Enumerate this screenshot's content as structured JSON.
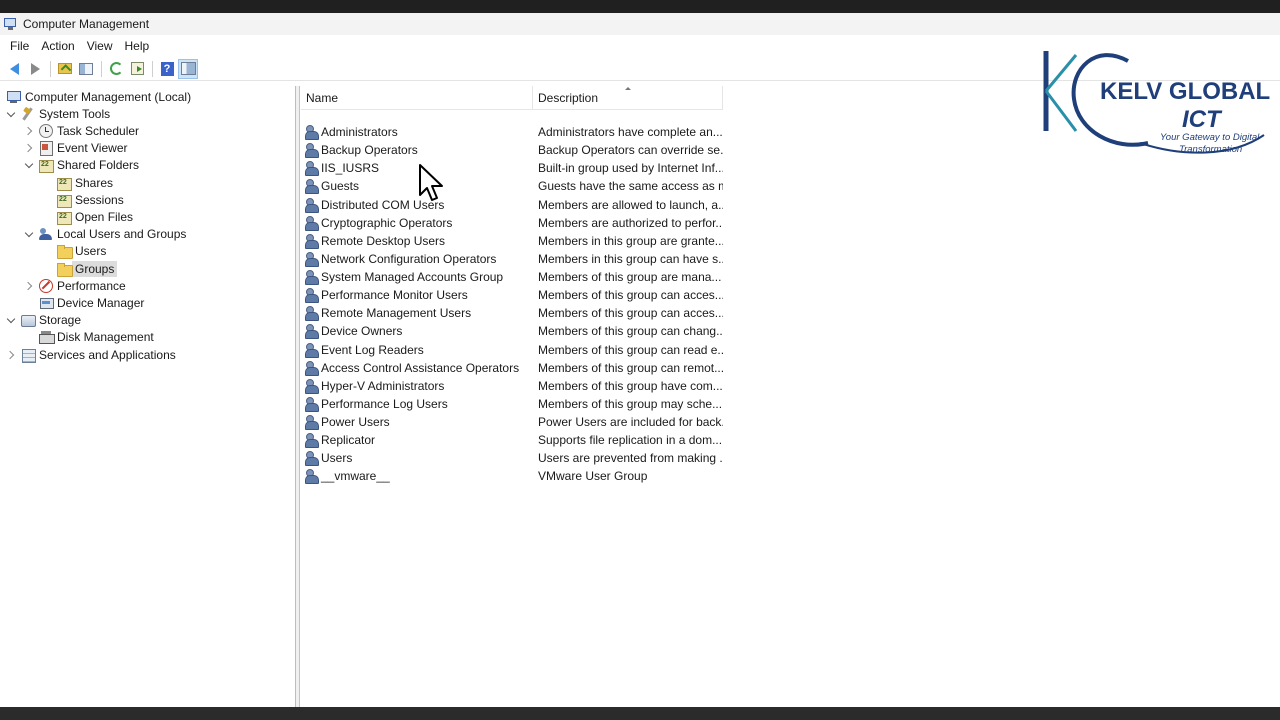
{
  "window": {
    "title": "Computer Management"
  },
  "menu": [
    "File",
    "Action",
    "View",
    "Help"
  ],
  "toolbar": {
    "buttons": [
      {
        "icon": "back-arrow-icon"
      },
      {
        "icon": "forward-arrow-icon"
      },
      {
        "icon": "up-folder-icon"
      },
      {
        "icon": "show-hide-console-tree-icon"
      },
      {
        "icon": "refresh-icon"
      },
      {
        "icon": "export-list-icon"
      },
      {
        "icon": "help-icon",
        "glyph": "?"
      },
      {
        "icon": "action-pane-icon"
      }
    ]
  },
  "tree": [
    {
      "label": "Computer Management (Local)",
      "icon": "computer",
      "level": 0,
      "expander": "none"
    },
    {
      "label": "System Tools",
      "icon": "tools",
      "level": 1,
      "expander": "down"
    },
    {
      "label": "Task Scheduler",
      "icon": "clock",
      "level": 2,
      "expander": "right"
    },
    {
      "label": "Event Viewer",
      "icon": "viewer",
      "level": 2,
      "expander": "right"
    },
    {
      "label": "Shared Folders",
      "icon": "shared",
      "level": 2,
      "expander": "down"
    },
    {
      "label": "Shares",
      "icon": "shared",
      "level": 3,
      "expander": "none"
    },
    {
      "label": "Sessions",
      "icon": "shared",
      "level": 3,
      "expander": "none"
    },
    {
      "label": "Open Files",
      "icon": "shared",
      "level": 3,
      "expander": "none"
    },
    {
      "label": "Local Users and Groups",
      "icon": "users",
      "level": 2,
      "expander": "down"
    },
    {
      "label": "Users",
      "icon": "folder",
      "level": 3,
      "expander": "none"
    },
    {
      "label": "Groups",
      "icon": "folder",
      "level": 3,
      "expander": "none",
      "selected": true
    },
    {
      "label": "Performance",
      "icon": "perf",
      "level": 2,
      "expander": "right"
    },
    {
      "label": "Device Manager",
      "icon": "device",
      "level": 2,
      "expander": "none"
    },
    {
      "label": "Storage",
      "icon": "storage",
      "level": 1,
      "expander": "down"
    },
    {
      "label": "Disk Management",
      "icon": "disk",
      "level": 2,
      "expander": "none"
    },
    {
      "label": "Services and Applications",
      "icon": "services",
      "level": 1,
      "expander": "right"
    }
  ],
  "columns": {
    "name": "Name",
    "description": "Description"
  },
  "groups": [
    {
      "name": "Administrators",
      "description": "Administrators have complete an..."
    },
    {
      "name": "Backup Operators",
      "description": "Backup Operators can override se..."
    },
    {
      "name": "IIS_IUSRS",
      "description": "Built-in group used by Internet Inf..."
    },
    {
      "name": "Guests",
      "description": "Guests have the same access as m..."
    },
    {
      "name": "Distributed COM Users",
      "description": "Members are allowed to launch, a..."
    },
    {
      "name": "Cryptographic Operators",
      "description": "Members are authorized to perfor..."
    },
    {
      "name": "Remote Desktop Users",
      "description": "Members in this group are grante..."
    },
    {
      "name": "Network Configuration Operators",
      "description": "Members in this group can have s..."
    },
    {
      "name": "System Managed Accounts Group",
      "description": "Members of this group are mana..."
    },
    {
      "name": "Performance Monitor Users",
      "description": "Members of this group can acces..."
    },
    {
      "name": "Remote Management Users",
      "description": "Members of this group can acces..."
    },
    {
      "name": "Device Owners",
      "description": "Members of this group can chang..."
    },
    {
      "name": "Event Log Readers",
      "description": "Members of this group can read e..."
    },
    {
      "name": "Access Control Assistance Operators",
      "description": "Members of this group can remot..."
    },
    {
      "name": "Hyper-V Administrators",
      "description": "Members of this group have com..."
    },
    {
      "name": "Performance Log Users",
      "description": "Members of this group may sche..."
    },
    {
      "name": "Power Users",
      "description": "Power Users are included for back..."
    },
    {
      "name": "Replicator",
      "description": "Supports file replication in a dom..."
    },
    {
      "name": "Users",
      "description": "Users are prevented from making ..."
    },
    {
      "name": "__vmware__",
      "description": "VMware User Group"
    }
  ],
  "logo": {
    "brand": "KELV GLOBAL",
    "sub": "ICT",
    "tagline_1": "Your Gateway to Digital",
    "tagline_2": "Transformation",
    "colors": {
      "primary": "#1f3f7a",
      "accent": "#2a8fa8"
    }
  }
}
